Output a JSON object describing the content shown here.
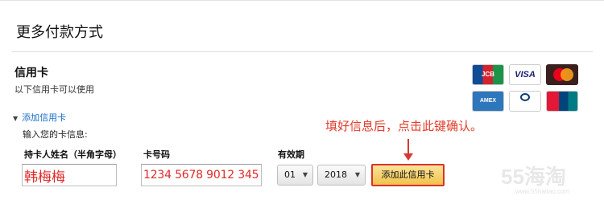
{
  "page": {
    "title": "更多付款方式"
  },
  "credit_card": {
    "title": "信用卡",
    "subtitle": "以下信用卡可以使用",
    "logos": [
      {
        "name": "JCB",
        "text": "JCB"
      },
      {
        "name": "VISA",
        "text": "VISA"
      },
      {
        "name": "MasterCard",
        "text": "MasterCard"
      },
      {
        "name": "American Express",
        "text": "AMEX"
      },
      {
        "name": "Diners Club International",
        "text": "Diners Club International"
      },
      {
        "name": "UnionPay",
        "text": "UnionPay 银联"
      }
    ]
  },
  "add_card": {
    "link_label": "添加信用卡",
    "prompt": "输入您的卡信息:",
    "instruction": "填好信息后，点击此键确认。",
    "fields": {
      "name_label": "持卡人姓名（半角字母）",
      "name_value": "韩梅梅",
      "card_label": "卡号码",
      "card_value": "1234 5678 9012 345",
      "expiry_label": "有效期",
      "month_value": "01",
      "year_value": "2018"
    },
    "button_label": "添加此信用卡"
  },
  "watermark": {
    "brand": "55海淘",
    "url": "www.55haitao.com"
  },
  "colors": {
    "link": "#1a6ec7",
    "annotation_red": "#e23c2b",
    "button_fill": "#f1c24b",
    "button_border": "#d8322c"
  }
}
